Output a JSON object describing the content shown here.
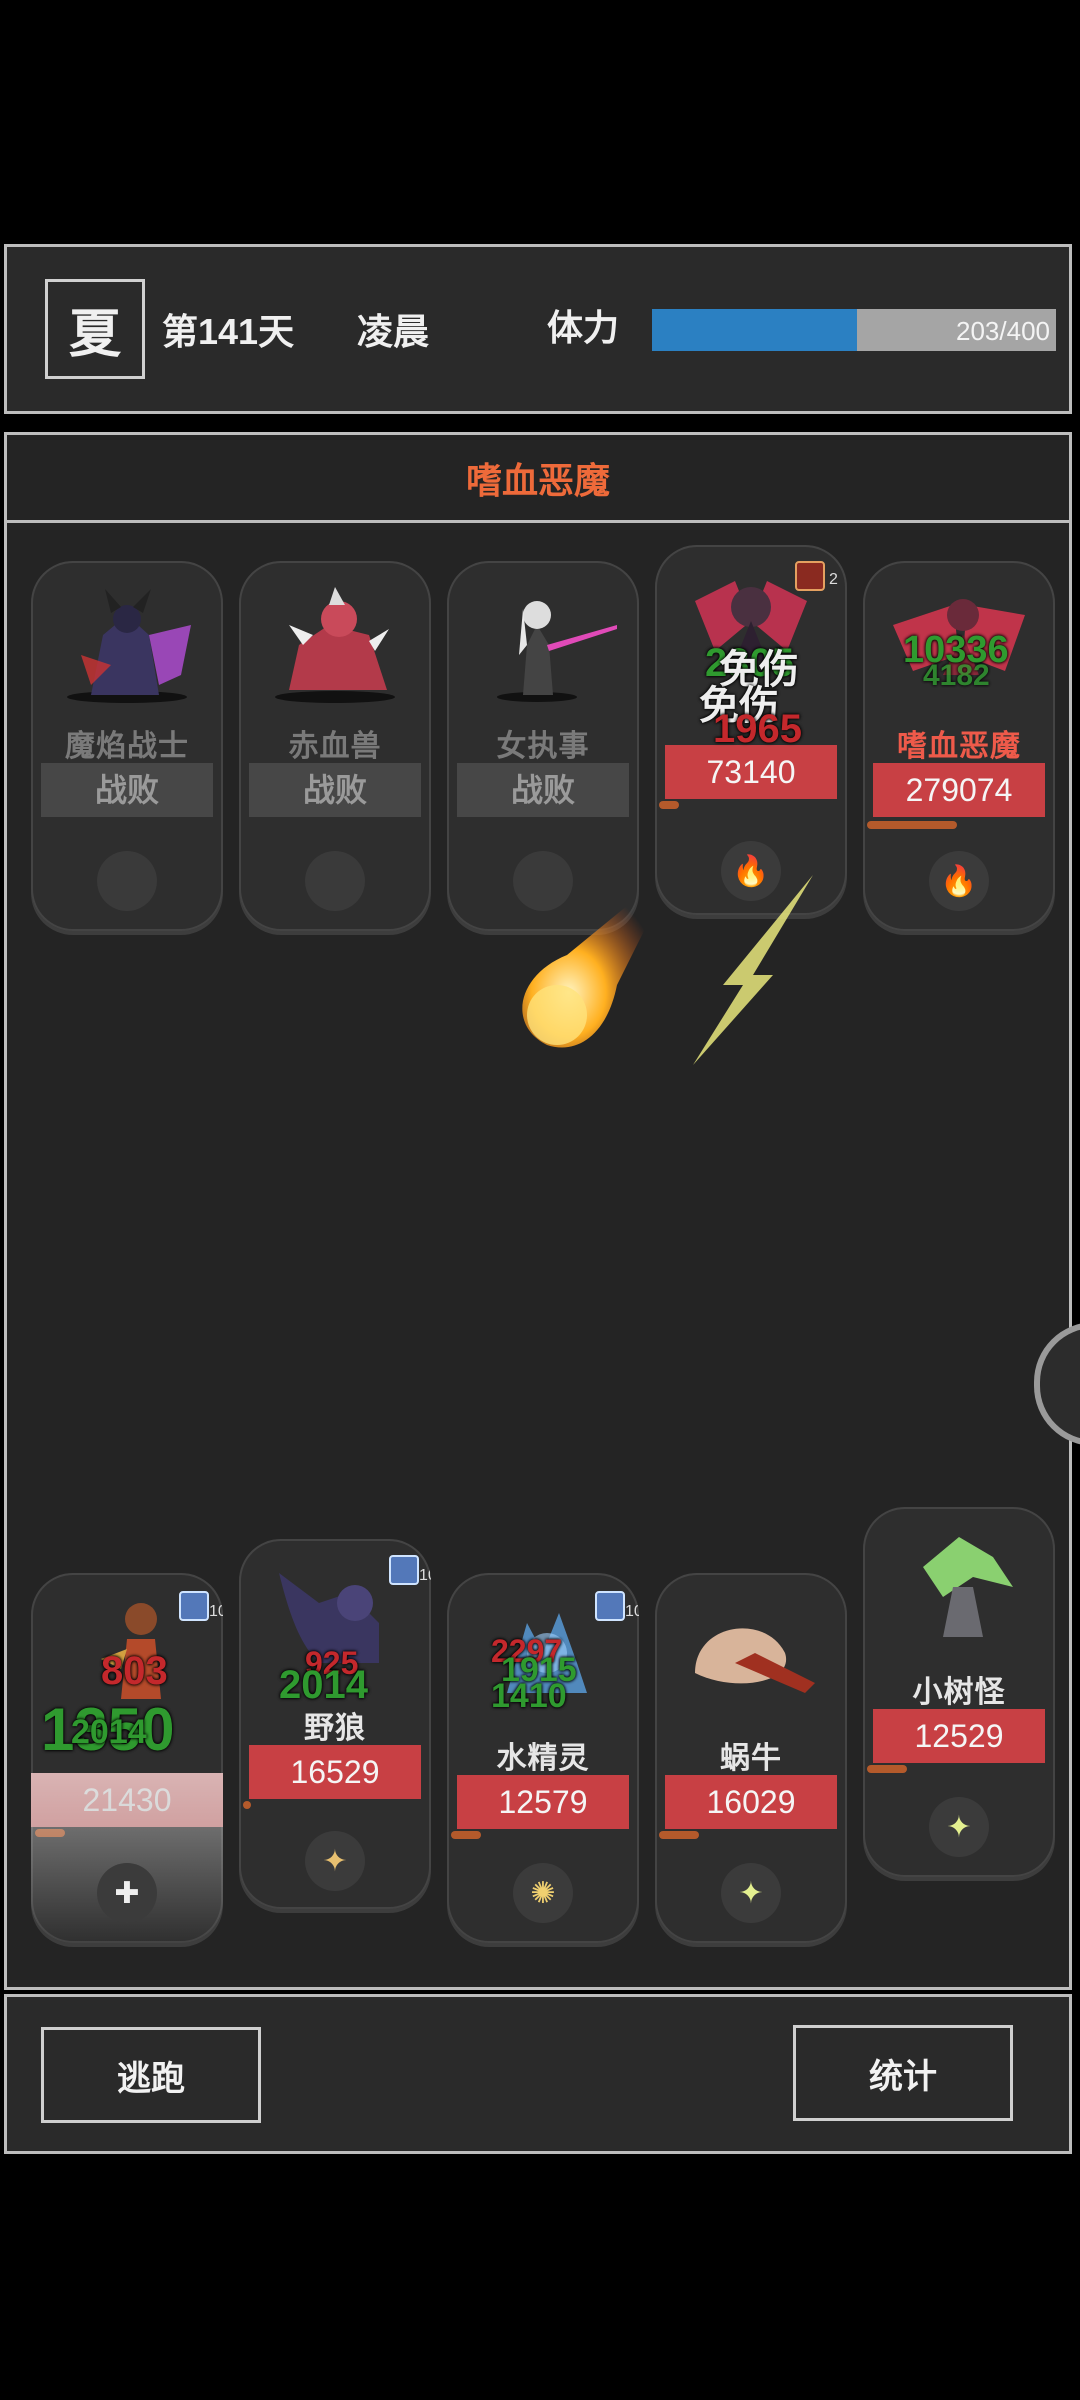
{
  "header": {
    "season": "夏",
    "day": "第141天",
    "time_of_day": "凌晨",
    "stamina_label": "体力",
    "stamina_text": "203/400",
    "stamina_fraction": 0.5075,
    "stamina_color": "#2b80c2"
  },
  "enemy_title": "嗜血恶魔",
  "enemies": [
    {
      "name": "魔焰战士",
      "status": "战败",
      "defeated": true
    },
    {
      "name": "赤血兽",
      "status": "战败",
      "defeated": true
    },
    {
      "name": "女执事",
      "status": "战败",
      "defeated": true
    },
    {
      "name": "",
      "hp": "73140",
      "defeated": false,
      "skill_icon": "fire-claw-icon",
      "buff_count": "2"
    },
    {
      "name": "嗜血恶魔",
      "hp": "279074",
      "defeated": false,
      "skill_icon": "fire-claw-icon"
    }
  ],
  "enemy_effects": {
    "dmg_green_1": "10336",
    "dmg_green_2": "4182",
    "dmg_green_3": "2305",
    "dmg_white_1": "免伤",
    "dmg_white_2": "免伤",
    "dmg_red_1": "1965"
  },
  "allies": [
    {
      "name": "",
      "hp": "21430",
      "badge": "10",
      "skill_icon": "heal-icon"
    },
    {
      "name": "野狼",
      "hp": "16529",
      "badge": "10",
      "skill_icon": "claw-icon"
    },
    {
      "name": "水精灵",
      "hp": "12579",
      "badge": "10",
      "skill_icon": "sparkle-icon"
    },
    {
      "name": "蜗牛",
      "hp": "16029",
      "skill_icon": "star-icon"
    },
    {
      "name": "小树怪",
      "hp": "12529",
      "skill_icon": "star-icon"
    }
  ],
  "ally_effects": {
    "dmg_red_a": "803",
    "dmg_green_a": "1350",
    "dmg_green_b": "2014",
    "dmg_green_c": "2014",
    "dmg_red_b": "925",
    "dmg_red_c": "2297",
    "dmg_green_d": "1915",
    "dmg_green_e": "1410"
  },
  "buttons": {
    "flee": "逃跑",
    "stats": "统计"
  }
}
